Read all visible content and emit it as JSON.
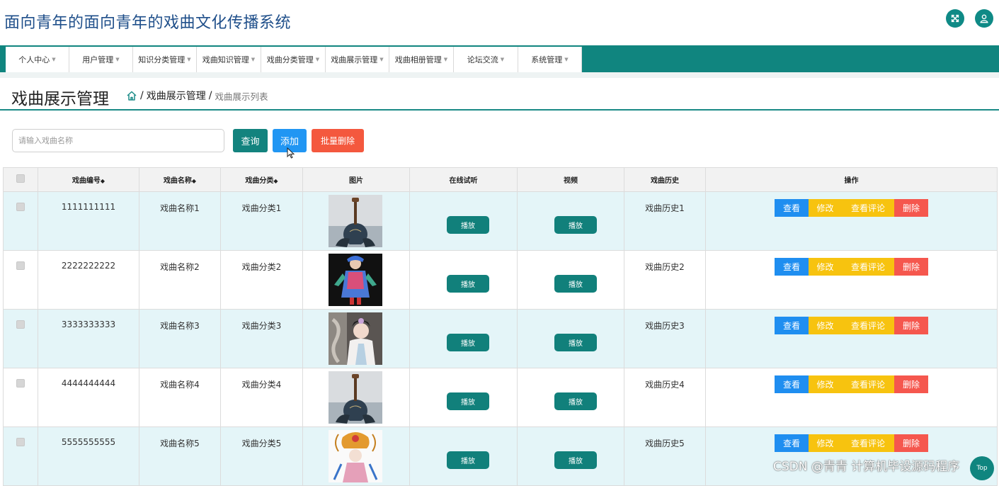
{
  "app": {
    "title": "面向青年的面向青年的戏曲文化传播系统"
  },
  "header_icons": [
    "fullscreen-icon",
    "user-icon"
  ],
  "nav": {
    "items": [
      {
        "label": "个人中心"
      },
      {
        "label": "用户管理"
      },
      {
        "label": "知识分类管理"
      },
      {
        "label": "戏曲知识管理"
      },
      {
        "label": "戏曲分类管理"
      },
      {
        "label": "戏曲展示管理"
      },
      {
        "label": "戏曲相册管理"
      },
      {
        "label": "论坛交流"
      },
      {
        "label": "系统管理"
      }
    ]
  },
  "page": {
    "title": "戏曲展示管理",
    "breadcrumb": {
      "sep": "/",
      "section": "戏曲展示管理",
      "current": "戏曲展示列表"
    }
  },
  "search": {
    "placeholder": "请输入戏曲名称",
    "value": ""
  },
  "buttons": {
    "query": "查询",
    "add": "添加",
    "batch_delete": "批量删除"
  },
  "table": {
    "headers": {
      "code": "戏曲编号",
      "name": "戏曲名称",
      "category": "戏曲分类",
      "image": "图片",
      "audio": "在线试听",
      "video": "视频",
      "history": "戏曲历史",
      "actions": "操作"
    },
    "sort_mark": "◆",
    "play_label": "播放",
    "action_labels": {
      "view": "查看",
      "edit": "修改",
      "comments": "查看评论",
      "delete": "删除"
    },
    "rows": [
      {
        "code": "1111111111",
        "name": "戏曲名称1",
        "category": "戏曲分类1",
        "history": "戏曲历史1",
        "image": "pipa-instrument"
      },
      {
        "code": "2222222222",
        "name": "戏曲名称2",
        "category": "戏曲分类2",
        "history": "戏曲历史2",
        "image": "opera-costume-figure"
      },
      {
        "code": "3333333333",
        "name": "戏曲名称3",
        "category": "戏曲分类3",
        "history": "戏曲历史3",
        "image": "opera-actress-portrait"
      },
      {
        "code": "4444444444",
        "name": "戏曲名称4",
        "category": "戏曲分类4",
        "history": "戏曲历史4",
        "image": "pipa-instrument"
      },
      {
        "code": "5555555555",
        "name": "戏曲名称5",
        "category": "戏曲分类5",
        "history": "戏曲历史5",
        "image": "opera-headdress"
      }
    ]
  },
  "watermark": "CSDN @青青  计算机毕设源码程序",
  "float_button": "Top",
  "colors": {
    "primary": "#10857f",
    "blue": "#1f8ef0",
    "yellow": "#f7c30f",
    "red": "#f5574e",
    "row_tint": "#e4f5f8"
  }
}
